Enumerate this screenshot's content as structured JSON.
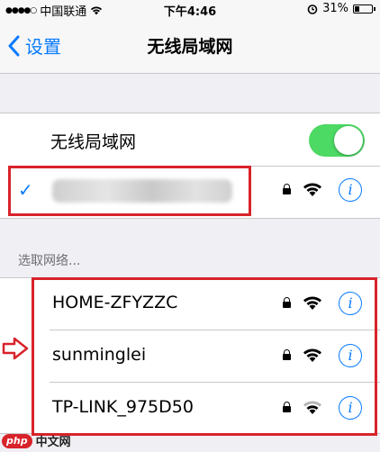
{
  "status_bar": {
    "carrier": "中国联通",
    "time": "下午4:46",
    "battery_percent": "31%",
    "battery_level": 0.31
  },
  "nav": {
    "back_label": "设置",
    "title": "无线局域网"
  },
  "wifi_toggle": {
    "label": "无线局域网",
    "on": true
  },
  "connected": {
    "name": "",
    "secured": true,
    "checked": true
  },
  "section_header": "选取网络...",
  "networks": [
    {
      "name": "HOME-ZFYZZC",
      "secured": true,
      "signal": "full"
    },
    {
      "name": "sunminglei",
      "secured": true,
      "signal": "full"
    },
    {
      "name": "TP-LINK_975D50",
      "secured": true,
      "signal": "medium"
    }
  ],
  "watermark": {
    "logo": "php",
    "text": "中文网"
  },
  "colors": {
    "accent": "#0a7bff",
    "toggle_on": "#4cd964",
    "highlight": "#d8232a"
  },
  "icons": [
    "chevron-left-icon",
    "checkmark-icon",
    "lock-icon",
    "wifi-icon",
    "info-icon",
    "alarm-icon",
    "arrow-right-icon"
  ]
}
